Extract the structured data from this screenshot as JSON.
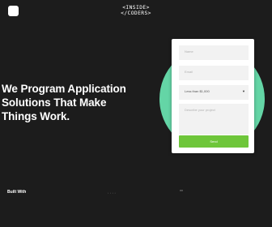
{
  "header": {
    "brand_line1": "<INSIDE>",
    "brand_line2": "</CODERS>"
  },
  "hero": {
    "line1": "We Program Application",
    "line2": "Solutions That Make",
    "line3": "Things Work."
  },
  "form": {
    "name_placeholder": "Name",
    "email_placeholder": "Email",
    "budget_value": "Less than $1,000",
    "description_placeholder": "Describe your project",
    "send_label": "Send"
  },
  "footer": {
    "built_with_label": "Built With"
  },
  "colors": {
    "background": "#1c1c1c",
    "accent_circle": "#64d5a6",
    "send_button": "#6ec63a"
  },
  "icons": {
    "logo": "logo-square-icon",
    "dropdown": "chevron-down-icon"
  }
}
